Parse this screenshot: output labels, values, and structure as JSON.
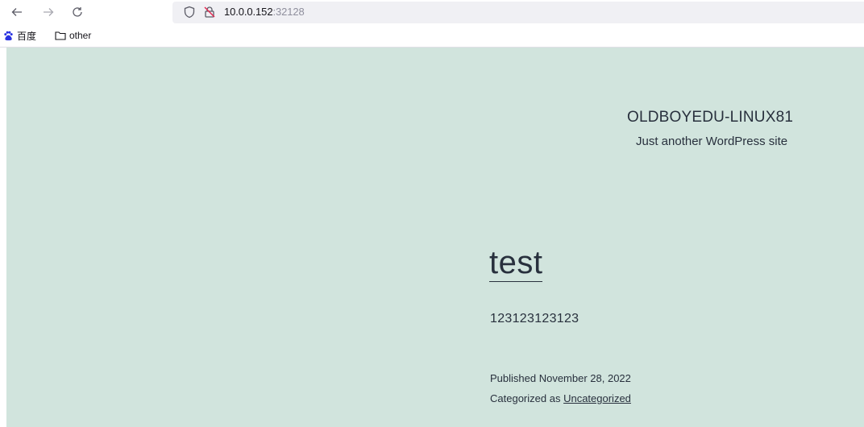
{
  "browser": {
    "back_icon": "arrow-left-icon",
    "forward_icon": "arrow-right-icon",
    "reload_icon": "reload-icon",
    "url_host": "10.0.0.152",
    "url_port": ":32128",
    "bookmarks": [
      {
        "icon": "baidu-paw-icon",
        "label": "百度"
      },
      {
        "icon": "folder-icon",
        "label": "other"
      }
    ]
  },
  "site": {
    "title": "OLDBOYEDU-LINUX81",
    "description": "Just another WordPress site",
    "background": "#d1e4dd"
  },
  "post": {
    "title": "test",
    "content": "123123123123",
    "published": "Published November 28, 2022",
    "categorized_prefix": "Categorized as",
    "category": "Uncategorized"
  }
}
